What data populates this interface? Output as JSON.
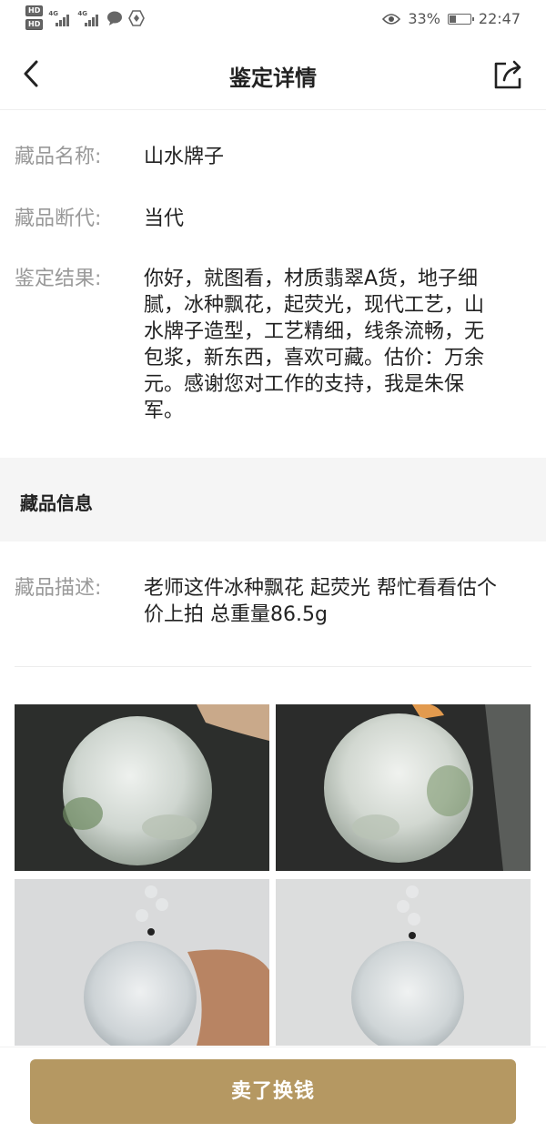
{
  "status_bar": {
    "hd1": "HD",
    "hd2": "HD",
    "net1": "4G",
    "net2": "4G",
    "battery_percent": "33%",
    "battery_level": 0.33,
    "time": "22:47"
  },
  "header": {
    "title": "鉴定详情"
  },
  "details": {
    "name_label": "藏品名称:",
    "name_value": "山水牌子",
    "era_label": "藏品断代:",
    "era_value": "当代",
    "result_label": "鉴定结果:",
    "result_value": "你好，就图看，材质翡翠A货，地子细腻，冰种飘花，起荧光，现代工艺，山水牌子造型，工艺精细，线条流畅，无包浆，新东西，喜欢可藏。估价：万余元。感谢您对工作的支持，我是朱保军。"
  },
  "info_section": {
    "title": "藏品信息"
  },
  "description": {
    "label": "藏品描述:",
    "value": "老师这件冰种飘花 起荧光 帮忙看看估个价上拍 总重量86.5g"
  },
  "footer": {
    "sell_label": "卖了换钱"
  }
}
